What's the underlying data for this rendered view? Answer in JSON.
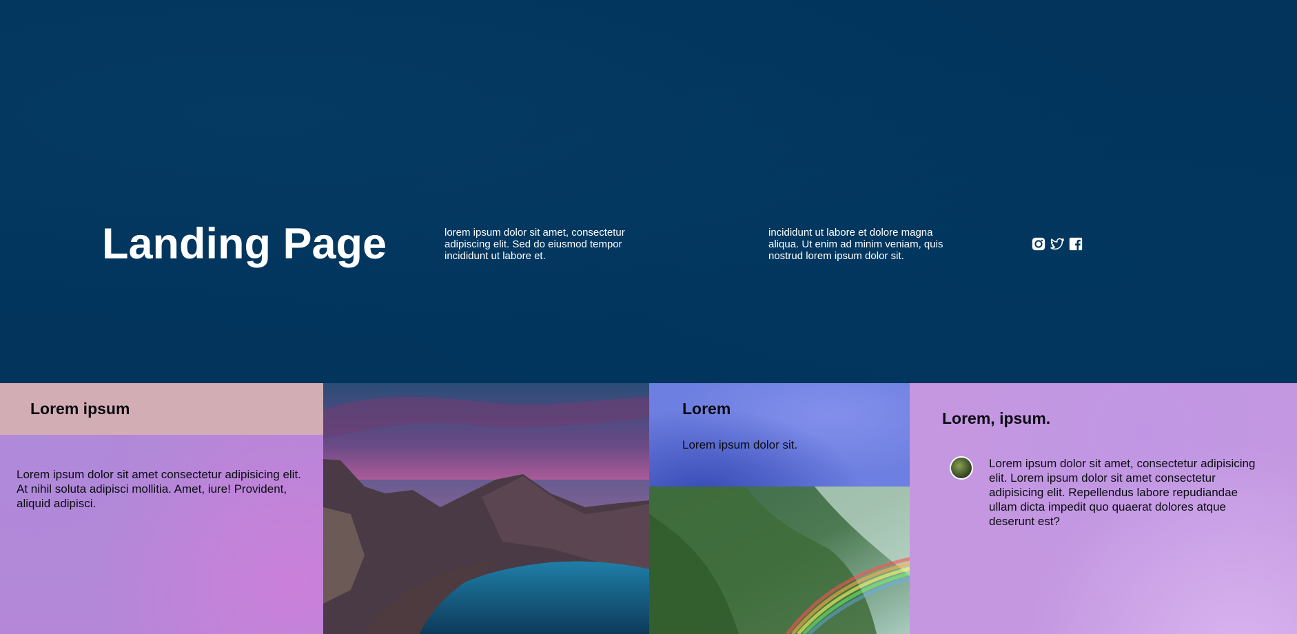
{
  "hero": {
    "title": "Landing Page",
    "text_one": "lorem ipsum dolor sit amet, consectetur adipiscing elit. Sed do eiusmod tempor incididunt ut labore et.",
    "text_two": "incididunt ut labore et dolore magna aliqua. Ut enim ad minim veniam, quis nostrud lorem ipsum dolor sit.",
    "social_icons": [
      "instagram-icon",
      "twitter-icon",
      "facebook-icon"
    ],
    "background_color": "#02345c"
  },
  "card_one": {
    "heading": "Lorem ipsum",
    "body": "Lorem ipsum dolor sit amet consectetur adipisicing elit. At nihil soluta adipisci mollitia. Amet, iure! Provident, aliquid adipisci."
  },
  "card_two": {
    "heading": "Lorem",
    "body": "Lorem ipsum dolor sit."
  },
  "card_three": {
    "heading": "Lorem, ipsum.",
    "body": "Lorem ipsum dolor sit amet, consectetur adipisicing elit. Lorem ipsum dolor sit amet consectetur adipisicing elit. Repellendus labore repudiandae ullam dicta impedit quo quaerat dolores atque deserunt est?"
  },
  "colors": {
    "peach": "#d2aeb4",
    "violet": "#b487d8",
    "periwinkle": "#6d7fe0",
    "lavender": "#c497e0"
  }
}
